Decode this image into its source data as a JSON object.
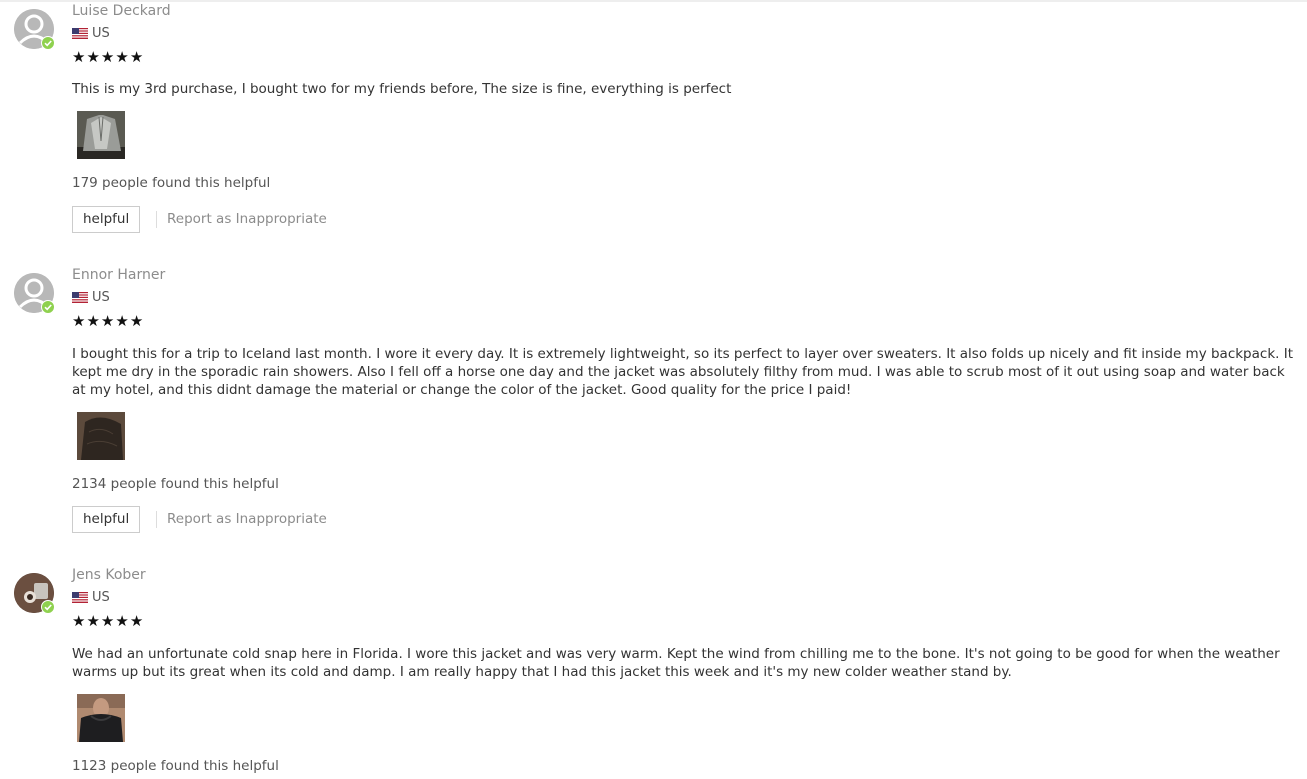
{
  "reviews": [
    {
      "name": "Luise Deckard",
      "country": "US",
      "rating": 5,
      "text": "This is my 3rd purchase, I bought two for my friends before, The size is fine, everything is perfect",
      "helpful_count": "179 people found this helpful",
      "helpful_label": "helpful",
      "report_label": "Report as Inappropriate"
    },
    {
      "name": "Ennor Harner",
      "country": "US",
      "rating": 5,
      "text": "I bought this for a trip to Iceland last month. I wore it every day. It is extremely lightweight, so its perfect to layer over sweaters. It also folds up nicely and fit inside my backpack. It kept me dry in the sporadic rain showers. Also I fell off a horse one day and the jacket was absolutely filthy from mud. I was able to scrub most of it out using soap and water back at my hotel, and this didnt damage the material or change the color of the jacket. Good quality for the price I paid!",
      "helpful_count": "2134 people found this helpful",
      "helpful_label": "helpful",
      "report_label": "Report as Inappropriate"
    },
    {
      "name": "Jens Kober",
      "country": "US",
      "rating": 5,
      "text": "We had an unfortunate cold snap here in Florida. I wore this jacket and was very warm. Kept the wind from chilling me to the bone. It's not going to be good for when the weather warms up but its great when its cold and damp. I am really happy that I had this jacket this week and it's my new colder weather stand by.",
      "helpful_count": "1123 people found this helpful"
    }
  ],
  "colors": {
    "verified": "#8fd14f",
    "star": "#111111",
    "muted_text": "#8c8c8c"
  },
  "icons": [
    "default-avatar-icon",
    "verified-check-icon",
    "us-flag-icon",
    "star-icon"
  ]
}
